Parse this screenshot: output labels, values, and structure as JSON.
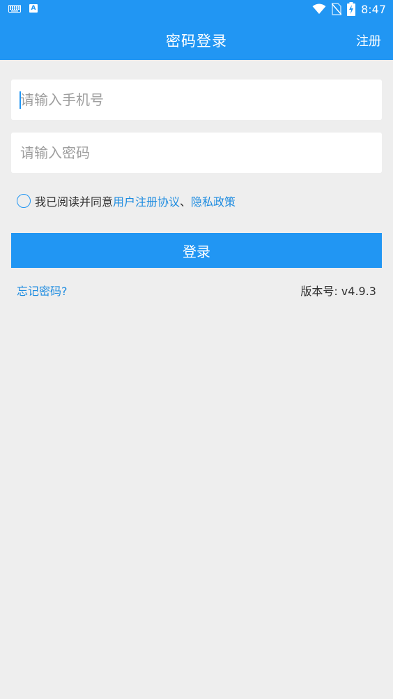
{
  "status_bar": {
    "time": "8:47",
    "icons": [
      "keyboard-icon",
      "a-notification-icon",
      "wifi-icon",
      "no-sim-icon",
      "battery-charging-icon"
    ]
  },
  "app_bar": {
    "title": "密码登录",
    "action_label": "注册"
  },
  "form": {
    "phone_placeholder": "请输入手机号",
    "phone_value": "",
    "password_placeholder": "请输入密码",
    "password_value": ""
  },
  "agreement": {
    "checked": false,
    "prefix": "我已阅读并同意",
    "user_agreement": "用户注册协议",
    "separator": "、",
    "privacy_policy": "隐私政策"
  },
  "login_button_label": "登录",
  "forgot_password_label": "忘记密码?",
  "version_text": "版本号: v4.9.3",
  "colors": {
    "primary": "#2196f3",
    "link": "#1e8ce0",
    "background": "#eeeeee"
  }
}
